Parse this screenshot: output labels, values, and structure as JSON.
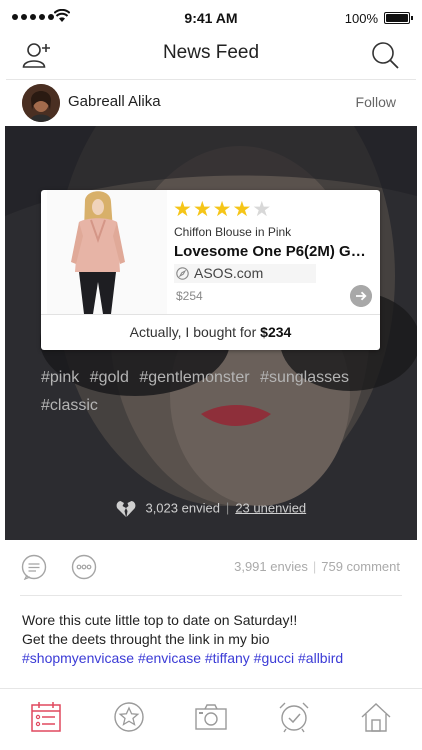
{
  "status_bar": {
    "time": "9:41 AM",
    "battery": "100%",
    "battery_level": 1.0
  },
  "nav": {
    "title": "News Feed",
    "left_icon": "add-user-icon",
    "right_icon": "search-icon"
  },
  "post": {
    "author": "Gabreall Alika",
    "follow_label": "Follow",
    "product": {
      "rating": 4,
      "rating_max": 5,
      "subtitle": "Chiffon Blouse in Pink",
      "name": "Lovesome One P6(2M) Gol···",
      "store": "ASOS.com",
      "price": "$254",
      "bought_prefix": "Actually, I bought for ",
      "bought_price": "$234"
    },
    "tags": [
      "#pink",
      "#gold",
      "#gentlemonster",
      "#sunglasses",
      "#classic"
    ],
    "envied_label": "3,023 envied",
    "unenvied_label": "23 unenvied",
    "envies_count": "3,991 envies",
    "comments_count": "759 comment",
    "caption_line1": "Wore this cute little top to date on Saturday!!",
    "caption_line2": "Get the deets throught the link in my bio",
    "caption_hashtags": "#shopmyenvicase #envicase #tiffany #gucci #allbird"
  },
  "tab_bar": {
    "items": [
      "calendar-list-icon",
      "star-icon",
      "camera-icon",
      "alarm-clock-icon",
      "home-icon"
    ],
    "active_index": 0
  },
  "colors": {
    "accent": "#e0485f",
    "hashtag": "#3b3bd6",
    "star_on": "#f5c518",
    "star_off": "#d8d8d8",
    "icon": "#9a9a9a"
  }
}
